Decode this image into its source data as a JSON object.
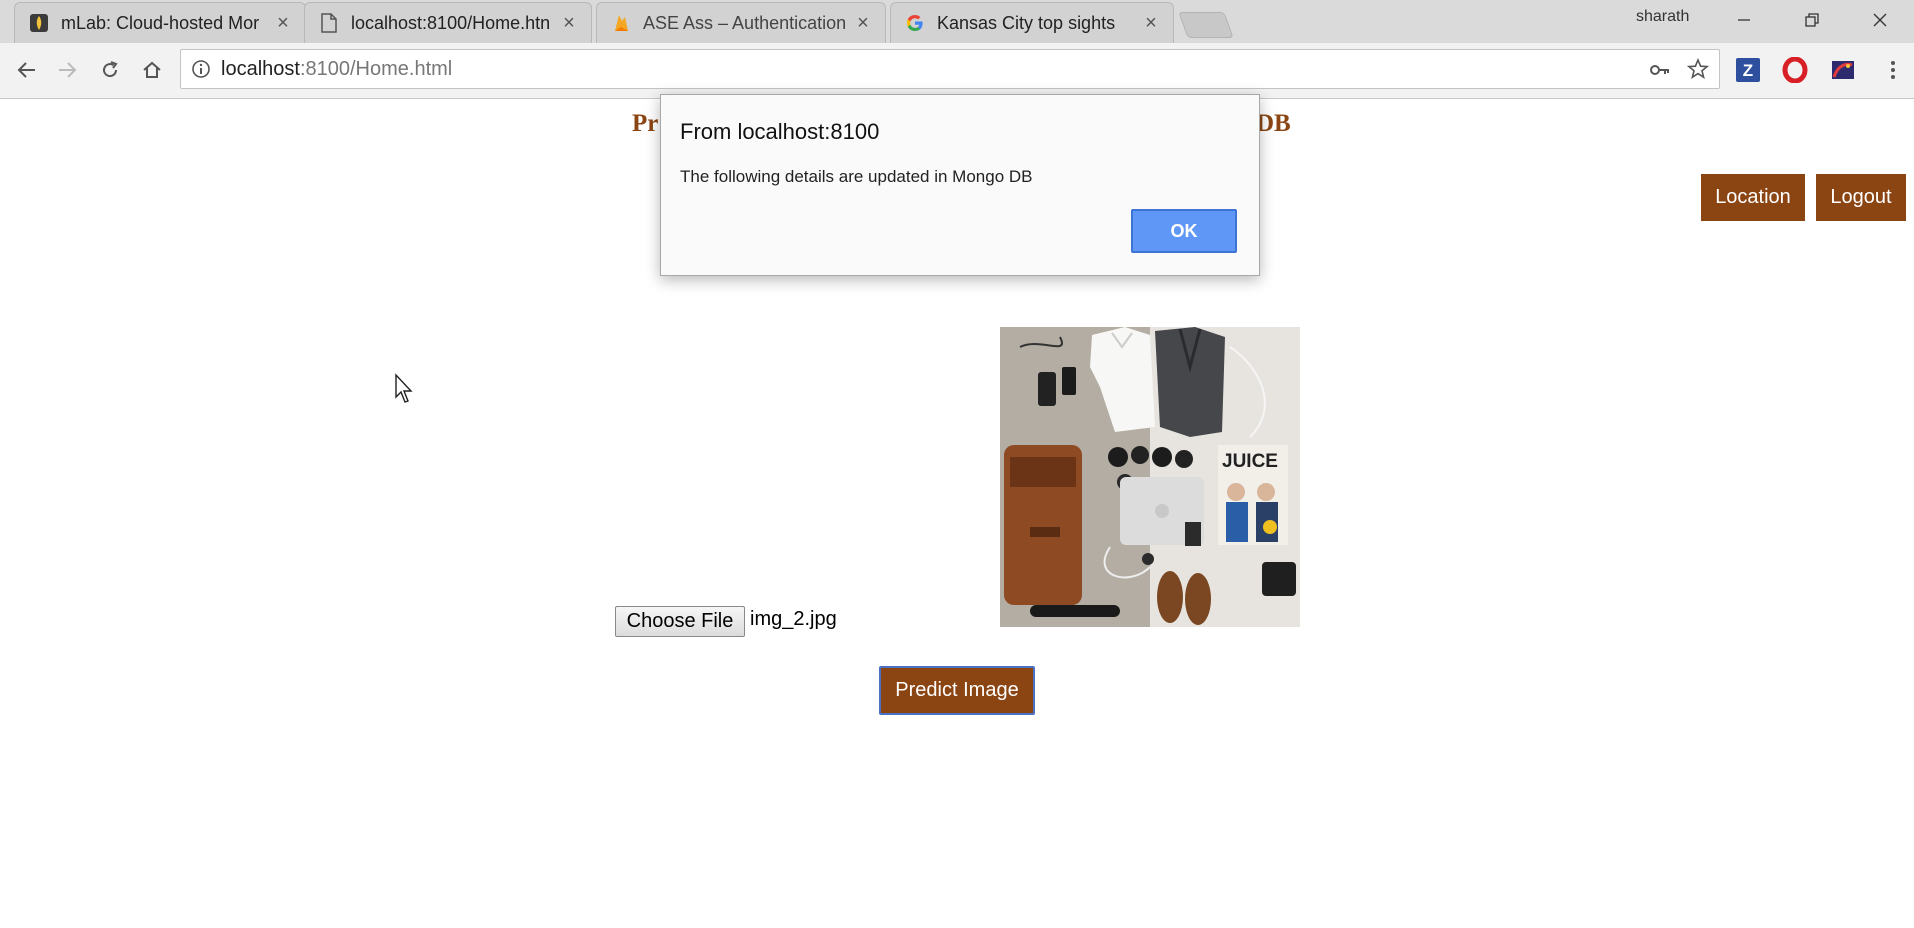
{
  "browser": {
    "tabs": [
      {
        "title": "mLab: Cloud-hosted Mor",
        "icon": "mlab-leaf-icon"
      },
      {
        "title": "localhost:8100/Home.htn",
        "icon": "document-icon"
      },
      {
        "title": "ASE Ass – Authentication",
        "icon": "firebase-flame-icon"
      },
      {
        "title": "Kansas City top sights",
        "icon": "google-g-icon"
      }
    ],
    "profile_name": "sharath",
    "address_host": "localhost",
    "address_path": ":8100/Home.html"
  },
  "page": {
    "heading_start": "Pr",
    "heading_end": "DB",
    "location_button": "Location",
    "logout_button": "Logout",
    "choose_file_button": "Choose File",
    "selected_file": "img_2.jpg",
    "predict_button": "Predict Image",
    "photo_caption": "JUICE"
  },
  "dialog": {
    "title": "From localhost:8100",
    "message": "The following details are updated in Mongo DB",
    "ok_label": "OK"
  },
  "colors": {
    "brand_brown": "#8b4513",
    "dialog_ok_blue": "#5e97f6"
  }
}
